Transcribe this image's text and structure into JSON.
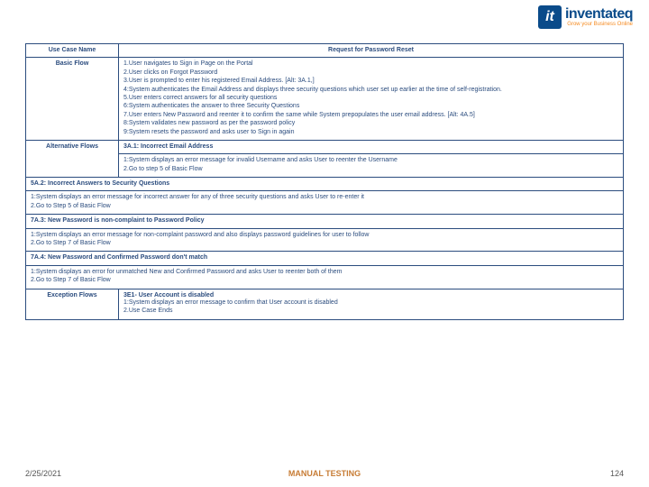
{
  "logo": {
    "name": "inventateq",
    "tagline": "Grow your Business Online"
  },
  "table": {
    "use_case_name_label": "Use Case Name",
    "use_case_name_value": "Request for Password Reset",
    "basic_flow_label": "Basic Flow",
    "basic_flow_steps": [
      "1.User navigates to Sign in Page on the Portal",
      "2.User clicks on Forgot Password",
      "3.User is prompted to enter his registered Email Address. [Alt: 3A.1,]",
      "4:System authenticates the Email Address and displays three security questions which user set up earlier at the time of self-registration.",
      "5.User enters correct answers for all security questions",
      "6:System authenticates the answer to three Security Questions",
      "7.User enters New Password and reenter it to confirm the same while System prepopulates the user email address. [Alt: 4A.5]",
      "8:System validates new password as per the password policy",
      "9:System resets the password and asks user to Sign in again"
    ],
    "alt_label": "Alternative Flows",
    "alt_3A1_head": "3A.1: Incorrect Email Address",
    "alt_3A1_steps": [
      "1:System displays an error message for invalid Username and asks User to reenter the Username",
      "2.Go to step 5 of Basic Flow"
    ],
    "alt_5A2_head": "5A.2: Incorrect Answers to Security Questions",
    "alt_5A2_steps": [
      "1:System displays an error message for incorrect answer for any of three security questions and asks User to re-enter it",
      "2.Go to Step 5 of Basic Flow"
    ],
    "alt_7A3_head": "7A.3: New Password is non-complaint to Password Policy",
    "alt_7A3_steps": [
      "1:System displays an error message for non-complaint password and also displays password guidelines for user to follow",
      "2.Go to Step 7 of Basic Flow"
    ],
    "alt_7A4_head": "7A.4: New Password and Confirmed Password don't match",
    "alt_7A4_steps": [
      "1:System displays an error for unmatched New and Confirmed Password and asks User to reenter both of them",
      "2.Go to Step 7 of Basic Flow"
    ],
    "exc_label": "Exception Flows",
    "exc_3E1_head": "3E1- User Account is disabled",
    "exc_3E1_steps": [
      "1:System displays an error message to confirm that User account is disabled",
      "2.Use Case Ends"
    ]
  },
  "footer": {
    "date": "2/25/2021",
    "center": "MANUAL TESTING",
    "page": "124"
  }
}
